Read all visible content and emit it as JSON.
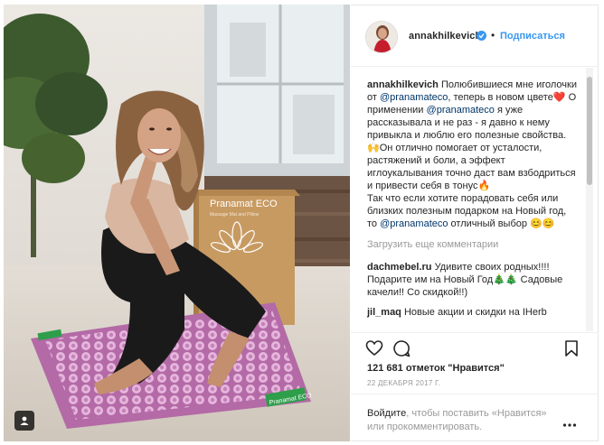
{
  "post": {
    "username": "annakhilkevich",
    "follow_label": "Подписаться",
    "separator": "•",
    "caption": {
      "author": "annakhilkevich",
      "part1": "Полюбившиеся мне иголочки от",
      "mention1": "@pranamateco",
      "part2": ", теперь в новом цвете❤️ О применении",
      "mention2": "@pranamateco",
      "part3": "я уже рассказывала и не раз - я давно к нему привыкла и люблю его полезные свойства. 🙌Он отлично помогает от усталости, растяжений и боли, а эффект иглоукалывания точно даст вам взбодриться и привести себя в тонус🔥",
      "part4": "Так что если хотите порадовать себя или близких полезным подарком на Новый год, то",
      "mention3": "@pranamateco",
      "part5": "отличный выбор 😊😊"
    },
    "load_more_label": "Загрузить еще комментарии",
    "comments": [
      {
        "author": "dachmebel.ru",
        "text": "Удивите своих родных!!!! Подарите им на Новый Год🎄🎄 Садовые качели!! Со скидкой!!)"
      },
      {
        "author": "jil_maq",
        "text": "Новые акции и скидки на IHerb"
      }
    ],
    "likes": "121 681 отметок \"Нравится\"",
    "date": "22 ДЕКАБРЯ 2017 Г.",
    "login_prompt": {
      "link1": "Войдите",
      "text1": ", чтобы поставить «Нравится»",
      "text2": "или прокомментировать."
    }
  },
  "photo": {
    "box_brand": "Pranamat ECO",
    "box_subtitle": "Massage Mat and Pillow",
    "mat_label": "Pranamat ECO"
  },
  "colors": {
    "link_blue": "#3897f0",
    "mention_blue": "#003569",
    "mat_purple": "#b36aa6",
    "box_brown": "#c79a62"
  },
  "icons": [
    "heart-icon",
    "comment-icon",
    "bookmark-icon",
    "verified-icon",
    "more-icon",
    "photo-tag-icon"
  ]
}
